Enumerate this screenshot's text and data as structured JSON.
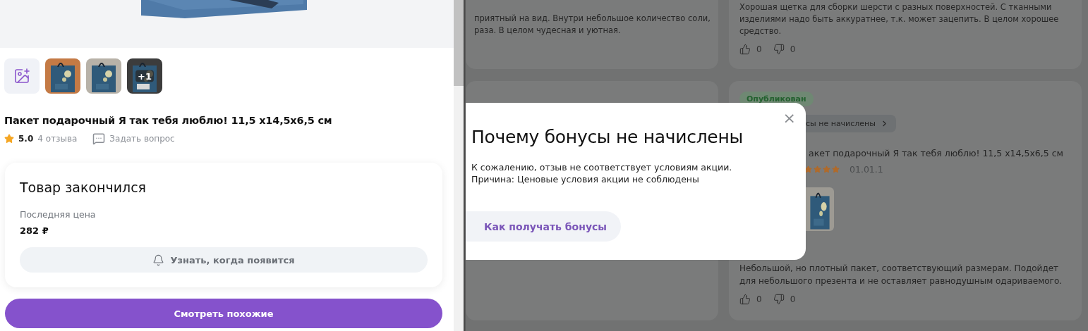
{
  "product": {
    "kind": "picture",
    "thumbnails": [
      {
        "kind": "picture"
      },
      {
        "kind": "picture"
      },
      {
        "kind": "picture",
        "more": "+1"
      }
    ],
    "title": "Пакет подарочный Я так тебя люблю! 11,5 x14,5x6,5 см",
    "rating": "5.0",
    "reviews_count": "4 отзыва",
    "ask_link": "Задать вопрос",
    "stock_card": {
      "heading": "Товар закончился",
      "price_label": "Последняя цена",
      "price": "282 ₽",
      "notify_button": "Узнать, когда появится"
    },
    "similar_button": "Смотреть похожие"
  },
  "reviews": [
    {
      "text_lines": [
        "приятный на вид. Внутри небольшое количество соли,",
        "раза. В целом чудесная и уютная."
      ]
    },
    {
      "text_lines": [
        "Хорошая щетка для сборки шерсти с разных поверхностей. С тканными",
        "изделиями надо быть аккуратнее, т.к. может зацепить. В целом хорошее",
        "средство."
      ],
      "likes": "0",
      "dislikes": "0"
    },
    {
      "status": "Опубликован",
      "bonus_chip": "сы не начислены",
      "product_title": "акет подарочный Я так тебя люблю! 11,5 x14,5x6,5 см",
      "stars": 4,
      "date": "01.01.1",
      "photo": {
        "kind": "picture"
      },
      "text": "Небольшой, но плотный пакет, соответствующий размерам. Подойдет для небольшого презента и не оставляет равнодушным одариваемого.",
      "likes": "0",
      "dislikes": "0"
    }
  ],
  "modal": {
    "title": "Почему бонусы не начислены",
    "lines": [
      "К сожалению, отзыв не соответствует условиям акции.",
      "Причина: Ценовые условия акции не соблюдены"
    ],
    "button": "Как получать бонусы",
    "close": "×"
  }
}
